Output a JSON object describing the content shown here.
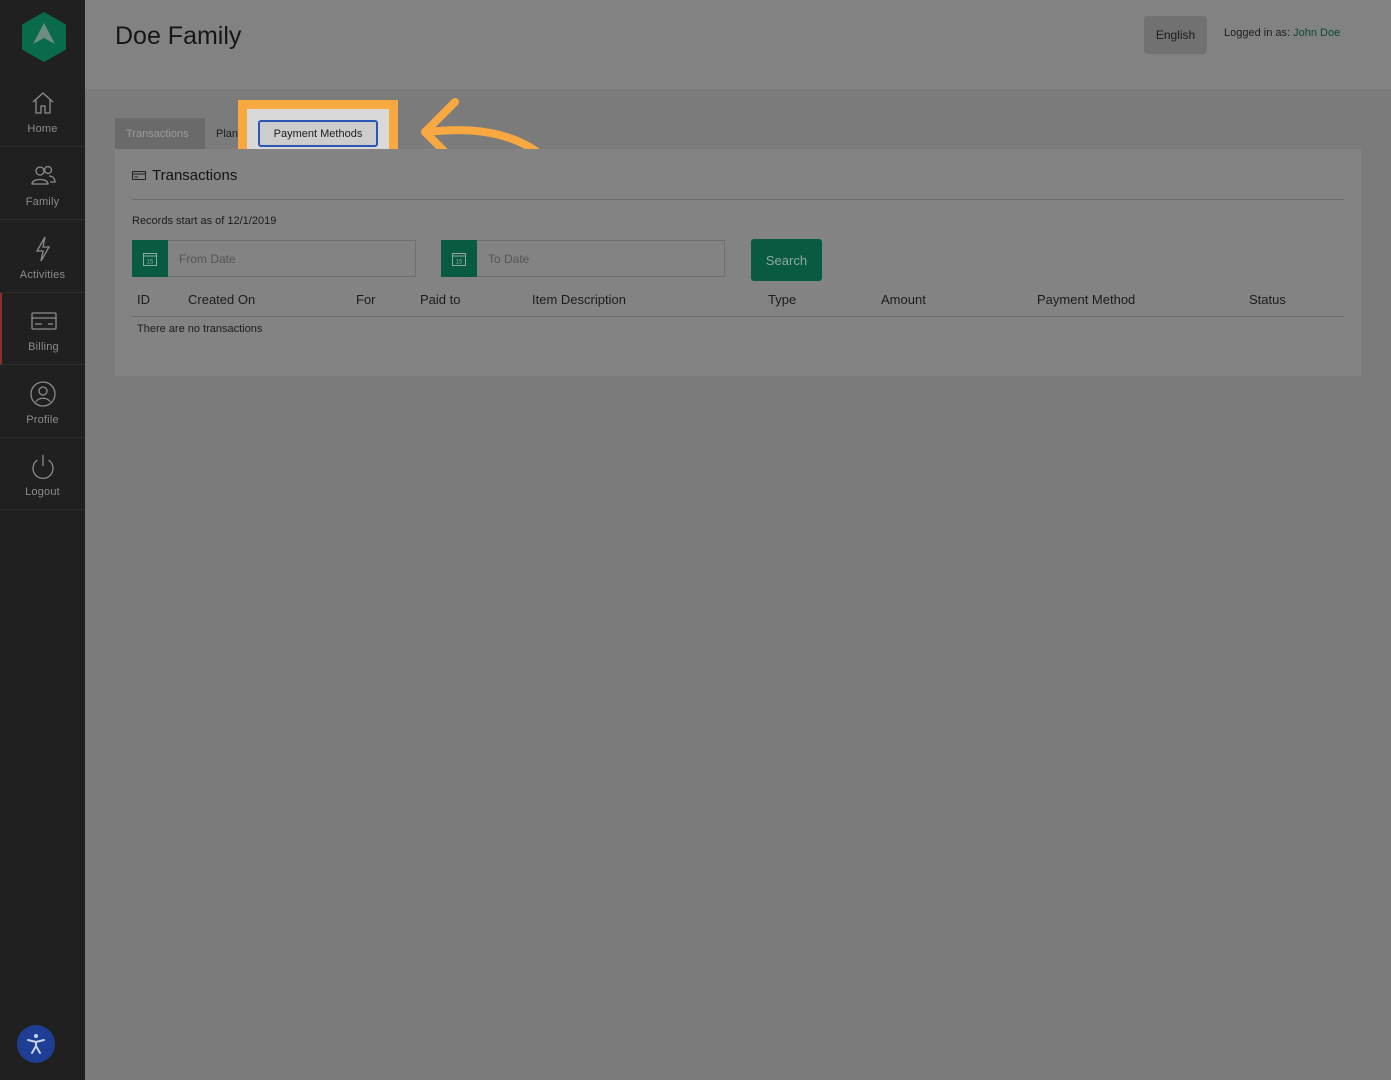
{
  "sidebar": {
    "items": [
      {
        "label": "Home",
        "icon": "home-icon"
      },
      {
        "label": "Family",
        "icon": "family-icon"
      },
      {
        "label": "Activities",
        "icon": "lightning-icon"
      },
      {
        "label": "Billing",
        "icon": "credit-card-icon"
      },
      {
        "label": "Profile",
        "icon": "user-icon"
      },
      {
        "label": "Logout",
        "icon": "power-icon"
      }
    ],
    "active": "Billing"
  },
  "header": {
    "title": "Doe Family",
    "language": "English",
    "logged_in_prefix": "Logged in as:",
    "user_name": "John Doe"
  },
  "tabs": {
    "transactions": "Transactions",
    "plans": "Plan",
    "payment_methods": "Payment Methods"
  },
  "panel": {
    "title": "Transactions",
    "records_note": "Records start as of 12/1/2019",
    "from_placeholder": "From Date",
    "to_placeholder": "To Date",
    "calendar_day": "15",
    "search_label": "Search",
    "columns": [
      "ID",
      "Created On",
      "For",
      "Paid to",
      "Item Description",
      "Type",
      "Amount",
      "Payment Method",
      "Status"
    ],
    "empty_message": "There are no transactions"
  },
  "colors": {
    "accent": "#095a42",
    "highlight": "#f7a841",
    "sidebar": "#202020"
  }
}
